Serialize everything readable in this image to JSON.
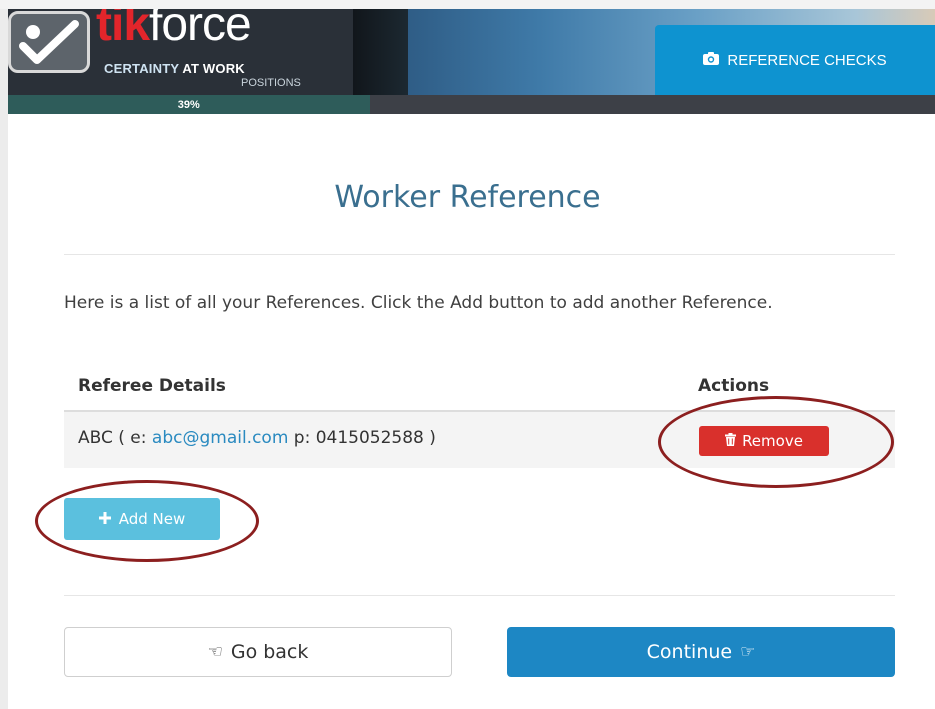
{
  "header": {
    "brand_red": "tik",
    "brand_white": "force",
    "tagline_prefix": "CERTAINTY",
    "tagline_suffix": "AT WORK",
    "subtitle": "POSITIONS",
    "tab_label": "REFERENCE CHECKS",
    "tab_icon": "camera-icon"
  },
  "progress": {
    "label": "39%",
    "value": 0.39
  },
  "page": {
    "title": "Worker Reference",
    "intro": "Here is a list of all your References. Click the Add button to add another Reference."
  },
  "table": {
    "columns": [
      "Referee Details",
      "Actions"
    ],
    "rows": [
      {
        "name_prefix": "ABC ( e: ",
        "email": "abc@gmail.com",
        "phone_part": " p: 0415052588 )",
        "action_label": "Remove",
        "action_icon": "trash-icon"
      }
    ]
  },
  "buttons": {
    "add_new": "Add New",
    "go_back": "Go back",
    "continue": "Continue"
  },
  "colors": {
    "header_bg": "#2a3038",
    "tab_blue": "#0e93d0",
    "title_blue": "#3a6f8f",
    "remove_red": "#d9302c",
    "add_cyan": "#5bc0de",
    "continue_blue": "#1d87c4",
    "annotation_oval": "#8c1f1f"
  }
}
